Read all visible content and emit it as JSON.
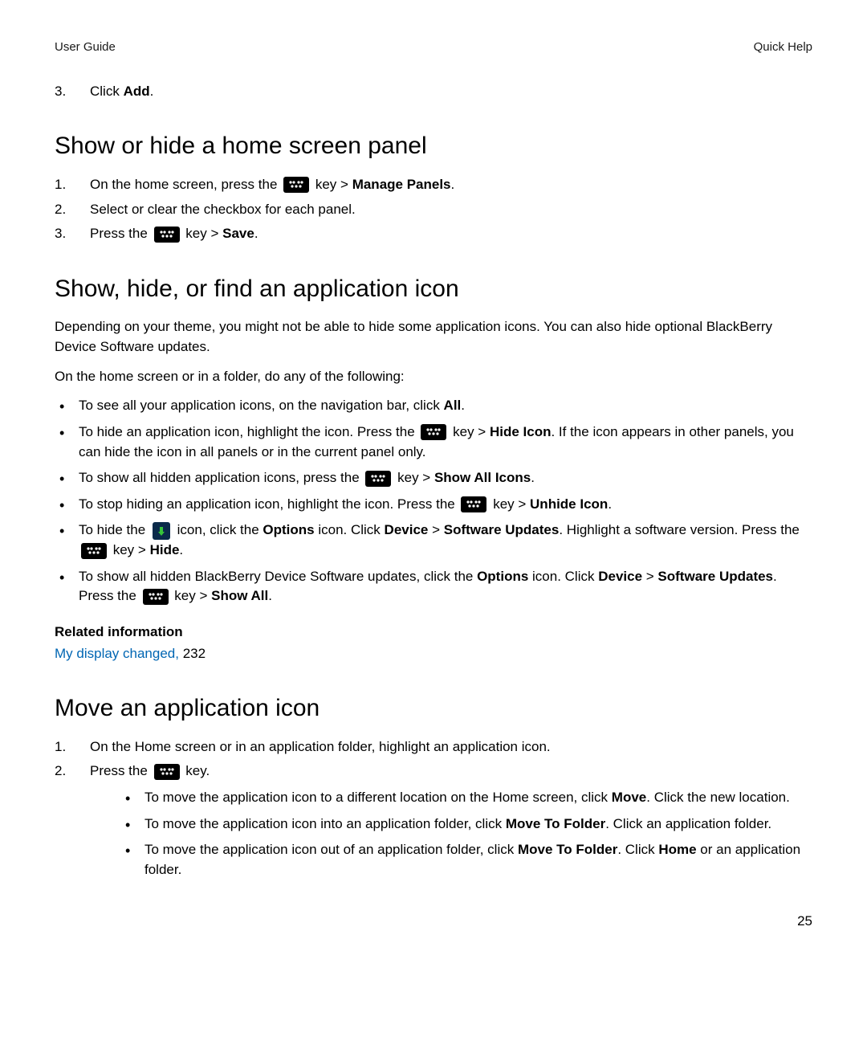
{
  "header": {
    "left": "User Guide",
    "right": "Quick Help"
  },
  "page_number": "25",
  "prev_list": {
    "items": [
      {
        "pre": "Click ",
        "bold": "Add",
        "post": "."
      }
    ]
  },
  "sec_panel": {
    "title": "Show or hide a home screen panel",
    "steps": [
      {
        "pre": "On the home screen, press the ",
        "key": true,
        "mid": " key > ",
        "bold": "Manage Panels",
        "post": "."
      },
      {
        "text": "Select or clear the checkbox for each panel."
      },
      {
        "pre": "Press the ",
        "key": true,
        "mid": " key > ",
        "bold": "Save",
        "post": "."
      }
    ]
  },
  "sec_icon": {
    "title": "Show, hide, or find an application icon",
    "intro": "Depending on your theme, you might not be able to hide some application icons. You can also hide optional BlackBerry Device Software updates.",
    "lead": "On the home screen or in a folder, do any of the following:",
    "bullets": {
      "b1": {
        "pre": "To see all your application icons, on the navigation bar, click ",
        "bold": "All",
        "post": "."
      },
      "b2": {
        "pre": "To hide an application icon, highlight the icon. Press the ",
        "mid": " key > ",
        "bold": "Hide Icon",
        "post": ". If the icon appears in other panels, you can hide the icon in all panels or in the current panel only."
      },
      "b3": {
        "pre": "To show all hidden application icons, press the ",
        "mid": " key > ",
        "bold": "Show All Icons",
        "post": "."
      },
      "b4": {
        "pre": "To stop hiding an application icon, highlight the icon. Press the ",
        "mid": " key > ",
        "bold": "Unhide Icon",
        "post": "."
      },
      "b5": {
        "pre": "To hide the ",
        "mid1": " icon, click the ",
        "bold1": "Options",
        "mid2": " icon. Click ",
        "bold2": "Device",
        "mid3": " > ",
        "bold3": "Software Updates",
        "mid4": ". Highlight a software version. Press the ",
        "mid5": " key > ",
        "bold4": "Hide",
        "post": "."
      },
      "b6": {
        "pre": "To show all hidden BlackBerry Device Software updates, click the ",
        "bold1": "Options",
        "mid1": " icon. Click ",
        "bold2": "Device",
        "mid2": " > ",
        "bold3": "Software Updates",
        "mid3": ". Press the ",
        "mid4": " key > ",
        "bold4": "Show All",
        "post": "."
      }
    },
    "related_title": "Related information",
    "related_link": "My display changed,",
    "related_pagenum": " 232"
  },
  "sec_move": {
    "title": "Move an application icon",
    "steps": {
      "s1": "On the Home screen or in an application folder, highlight an application icon.",
      "s2": {
        "pre": "Press the ",
        "mid": " key."
      }
    },
    "sub": {
      "a": {
        "pre": "To move the application icon to a different location on the Home screen, click ",
        "bold": "Move",
        "post": ". Click the new location."
      },
      "b": {
        "pre": "To move the application icon into an application folder, click ",
        "bold": "Move To Folder",
        "post": ". Click an application folder."
      },
      "c": {
        "pre": "To move the application icon out of an application folder, click ",
        "bold1": "Move To Folder",
        "mid": ". Click ",
        "bold2": "Home",
        "post": " or an application folder."
      }
    }
  }
}
